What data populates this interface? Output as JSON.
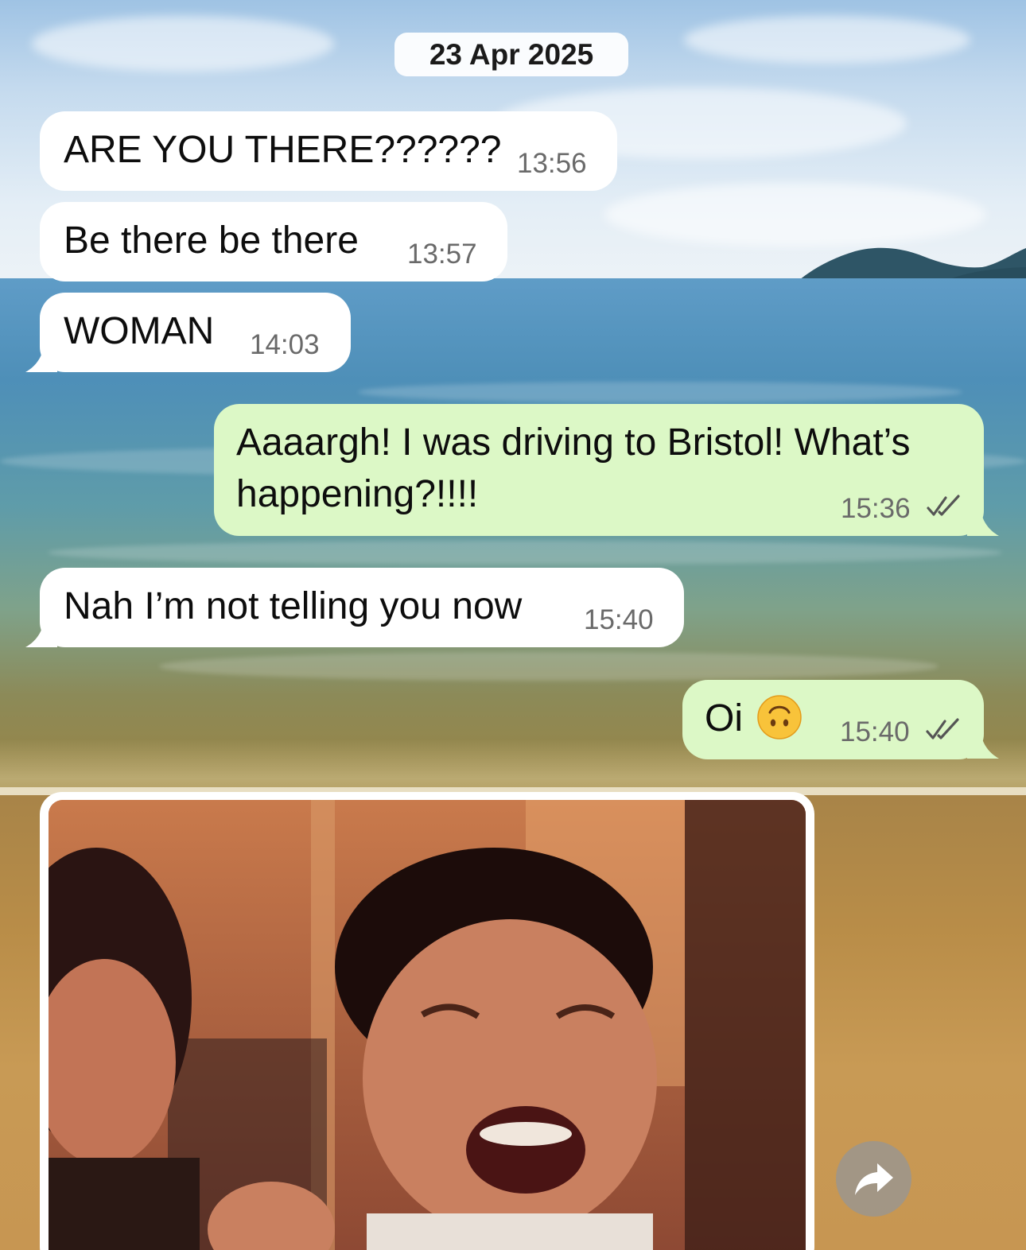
{
  "chat": {
    "date_separator": "23 Apr 2025",
    "messages": [
      {
        "direction": "incoming",
        "text": "ARE YOU THERE??????",
        "time": "13:56"
      },
      {
        "direction": "incoming",
        "text": "Be there be there",
        "time": "13:57"
      },
      {
        "direction": "incoming",
        "text": "WOMAN",
        "time": "14:03"
      },
      {
        "direction": "outgoing",
        "text_line1": "Aaaargh! I was driving to Bristol! What’s",
        "text_line2": "happening?!!!!",
        "time": "15:36",
        "status": "read",
        "status_icon": "double-check-icon"
      },
      {
        "direction": "incoming",
        "text": "Nah I’m not telling you now",
        "time": "15:40"
      },
      {
        "direction": "outgoing",
        "text": "Oi",
        "emoji": "upside-down-face",
        "time": "15:40",
        "status": "read",
        "status_icon": "double-check-icon"
      },
      {
        "direction": "incoming",
        "type": "image",
        "content": "gif-image"
      }
    ]
  },
  "actions": {
    "forward_icon": "forward-arrow-icon"
  },
  "colors": {
    "incoming_bubble": "#ffffff",
    "outgoing_bubble": "#dcf8c6",
    "time_text": "#6a6a6a",
    "message_text": "#0d0d0d"
  }
}
